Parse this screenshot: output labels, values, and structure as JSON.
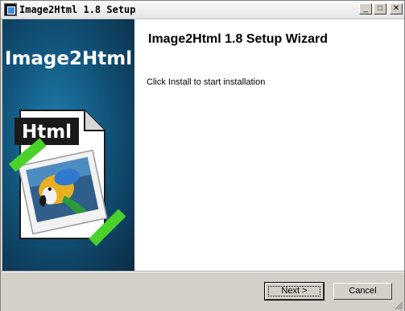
{
  "window": {
    "title": "Image2Html 1.8 Setup"
  },
  "titlebar_buttons": {
    "minimize": "_",
    "maximize": "□",
    "close": "✕"
  },
  "sidebar": {
    "brand": "Image2Html",
    "badge_text": "Html"
  },
  "main": {
    "heading": "Image2Html 1.8 Setup Wizard",
    "instruction": "Click Install to start installation"
  },
  "buttons": {
    "next": "Next >",
    "cancel": "Cancel"
  },
  "colors": {
    "sidebar_blue": "#12557c",
    "tape_green": "#4ad12a",
    "panel_white": "#ffffff"
  },
  "icons": [
    "app-setup-icon",
    "html-document-icon",
    "parrot-photo",
    "tape-strip"
  ]
}
